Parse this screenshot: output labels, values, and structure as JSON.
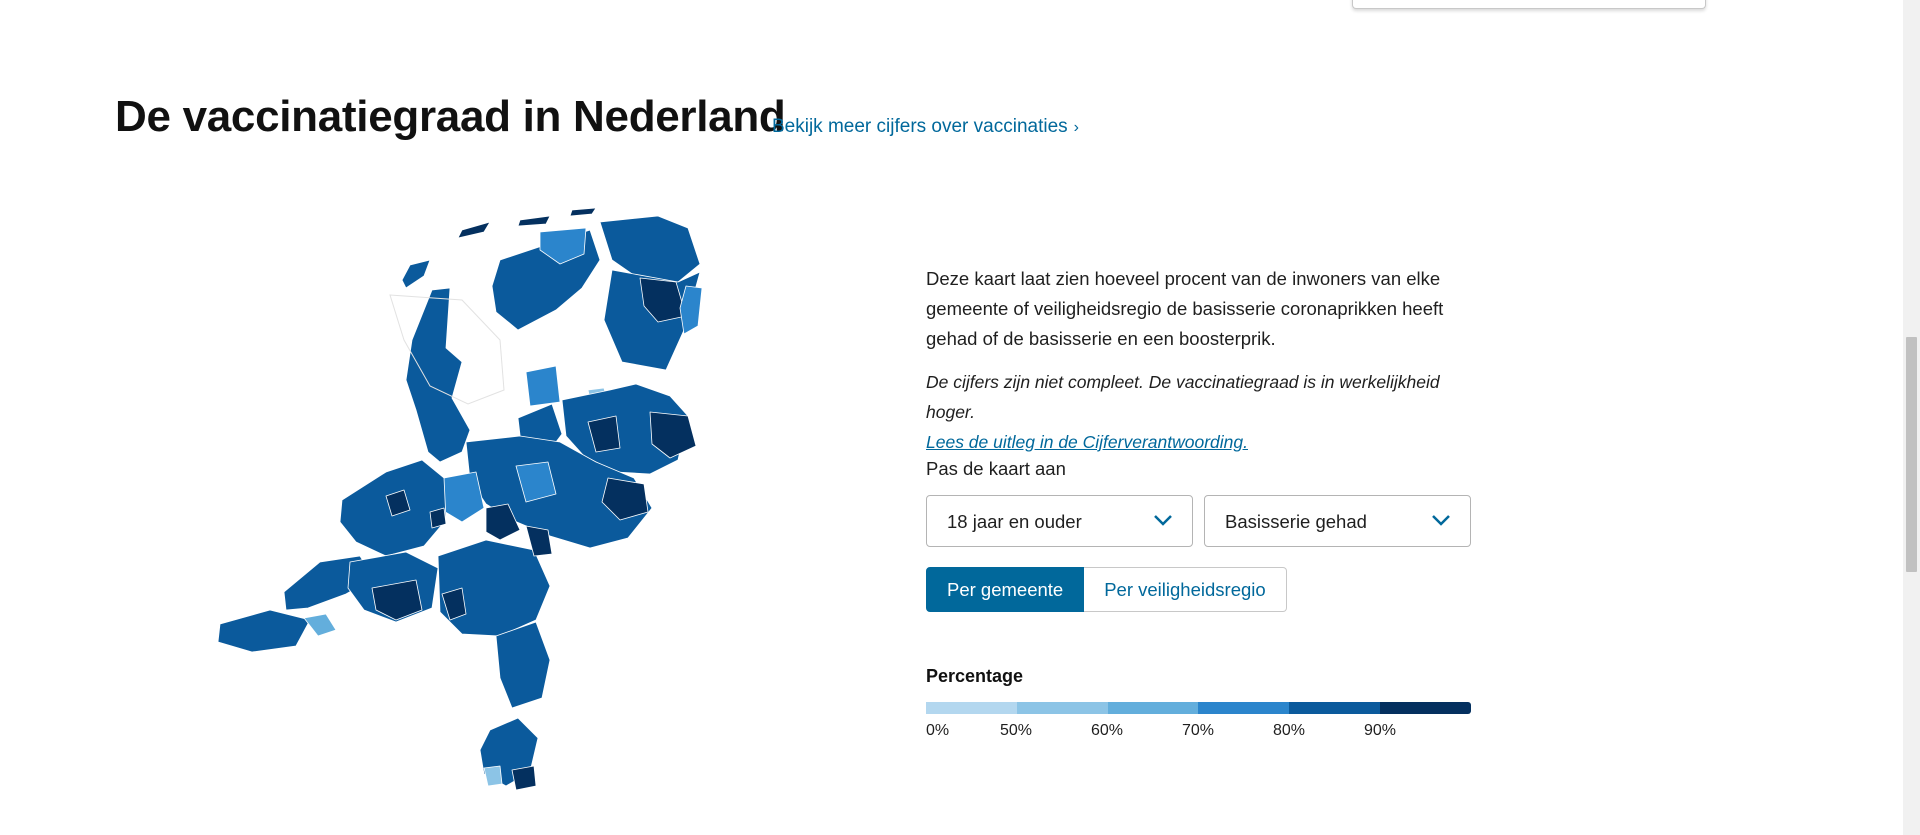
{
  "section": {
    "title": "De vaccinatiegraad in Nederland",
    "more_link": "Bekijk meer cijfers over vaccinaties"
  },
  "info": {
    "description": "Deze kaart laat zien hoeveel procent van de inwoners van elke gemeente of veiligheidsregio de basisserie coronaprikken heeft gehad of de basisserie en een boosterprik.",
    "note": "De cijfers zijn niet compleet. De vaccinatiegraad is in werkelijkheid hoger.",
    "note_link": "Lees de uitleg in de Cijferverantwoording."
  },
  "controls": {
    "adjust_label": "Pas de kaart aan",
    "age_select": "18 jaar en ouder",
    "type_select": "Basisserie gehad",
    "toggle_active": "Per gemeente",
    "toggle_inactive": "Per veiligheidsregio"
  },
  "legend": {
    "title": "Percentage",
    "labels": [
      "0%",
      "50%",
      "60%",
      "70%",
      "80%",
      "90%"
    ],
    "colors": [
      "#b3d7ef",
      "#8cc4e6",
      "#63aedc",
      "#2b85cc",
      "#0b5a9c",
      "#04305f"
    ]
  },
  "colors": {
    "accent": "#01689b",
    "map_base": "#0b5a9c"
  }
}
